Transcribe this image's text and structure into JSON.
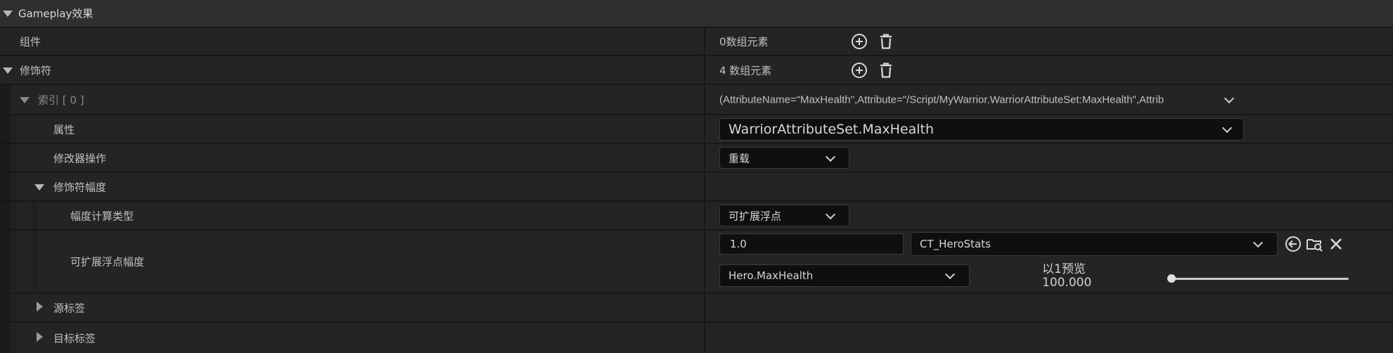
{
  "section": {
    "title": "Gameplay效果"
  },
  "rows": {
    "components": {
      "label": "组件",
      "value": "0数组元素"
    },
    "modifiers": {
      "label": "修饰符",
      "value": "4 数组元素"
    },
    "index0": {
      "label": "索引 [ 0 ]",
      "summary": "(AttributeName=\"MaxHealth\",Attribute=\"/Script/MyWarrior.WarriorAttributeSet:MaxHealth\",Attrib"
    },
    "attribute": {
      "label": "属性",
      "value": "WarriorAttributeSet.MaxHealth"
    },
    "modifier_op": {
      "label": "修改器操作",
      "value": "重载"
    },
    "magnitude": {
      "label": "修饰符幅度"
    },
    "magnitude_calc_type": {
      "label": "幅度计算类型",
      "value": "可扩展浮点"
    },
    "scalable_float": {
      "label": "可扩展浮点幅度",
      "value": "1.0",
      "curve_table": "CT_HeroStats",
      "row_name": "Hero.MaxHealth",
      "preview_label": "以1预览",
      "preview_value": "100.000",
      "preview_level_fraction": 0.0
    },
    "source_tags": {
      "label": "源标签"
    },
    "target_tags": {
      "label": "目标标签"
    }
  },
  "icons": [
    "chevron-down-icon",
    "add-element-icon",
    "trash-icon",
    "browse-back-icon",
    "browse-asset-icon",
    "clear-icon"
  ]
}
